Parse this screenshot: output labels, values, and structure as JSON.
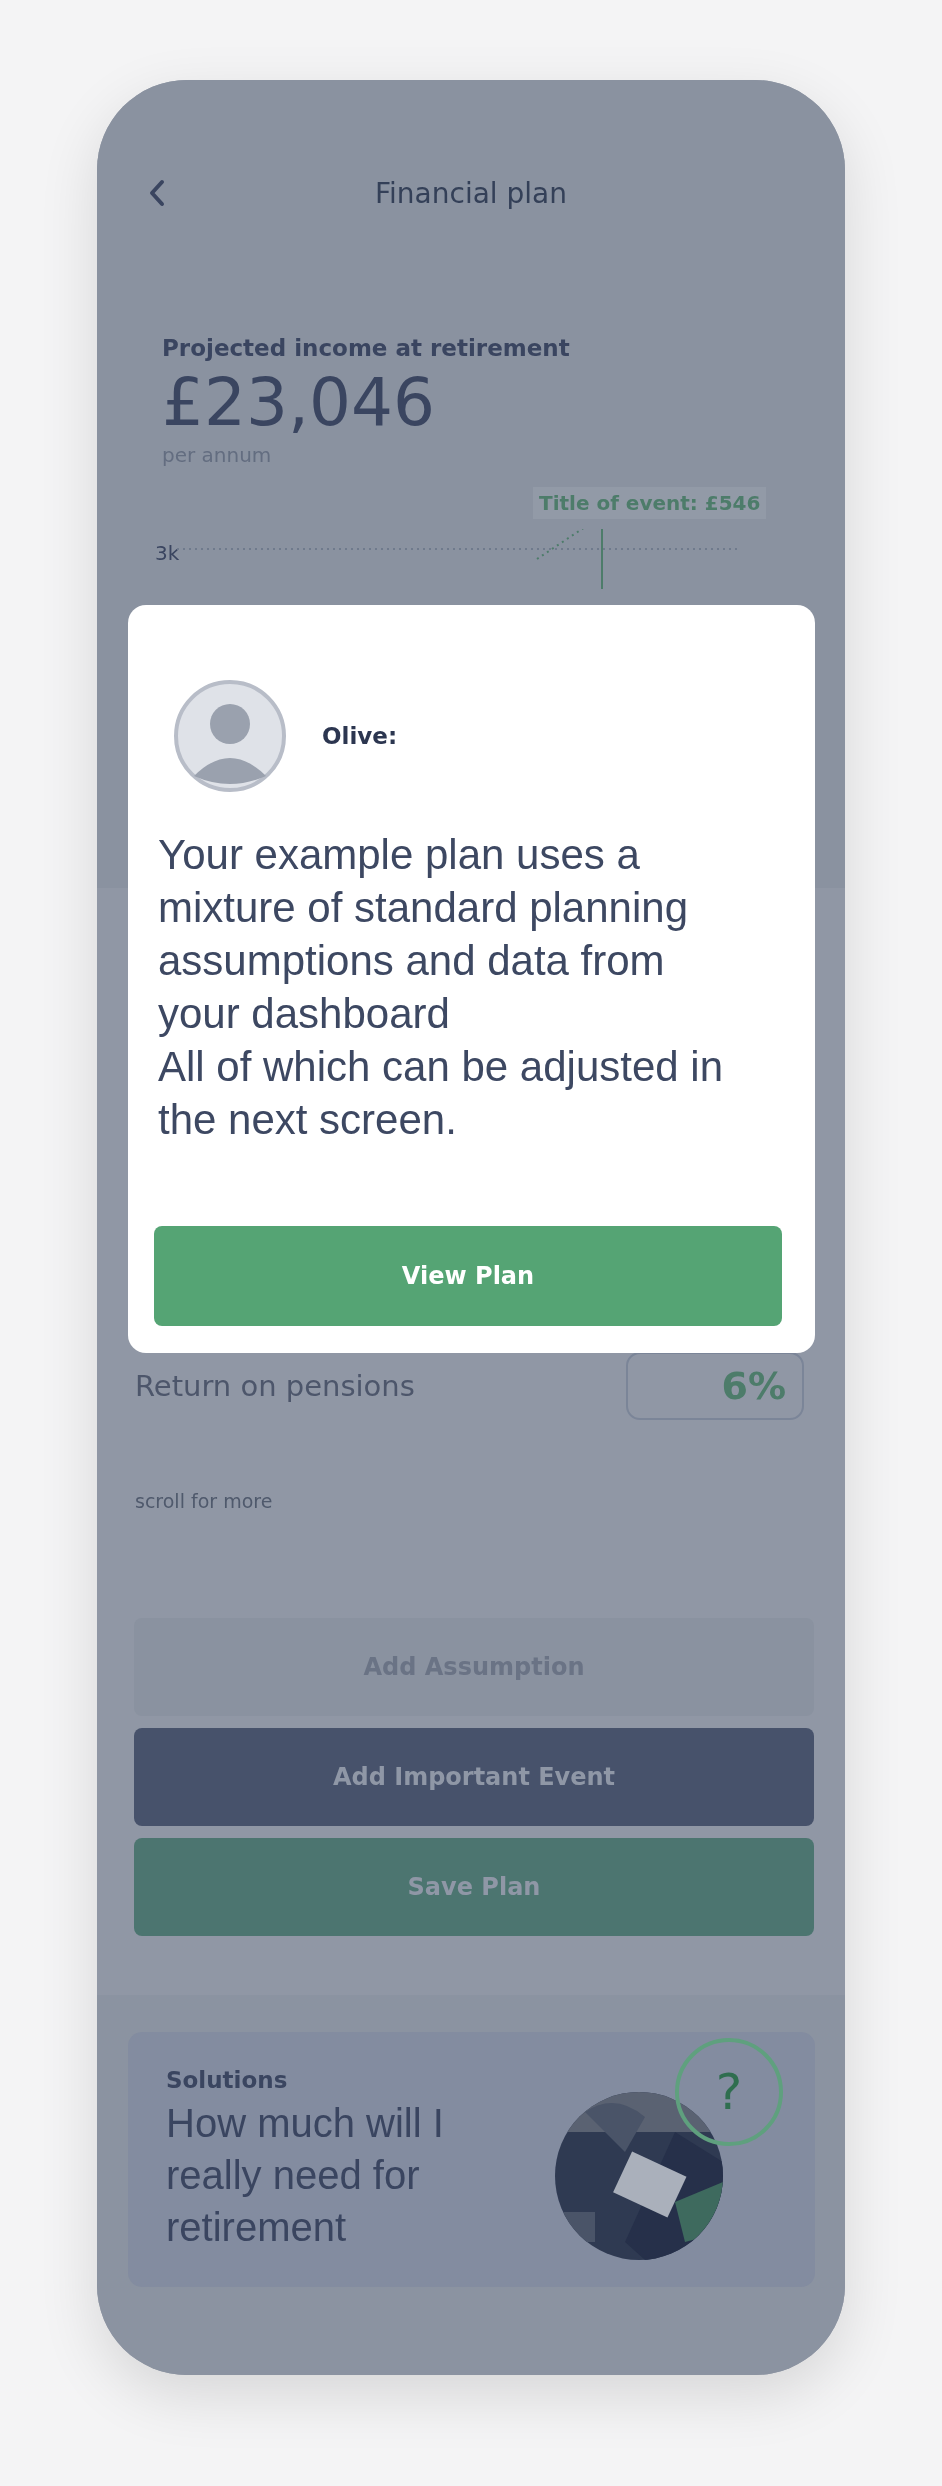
{
  "header": {
    "title": "Financial plan"
  },
  "summary": {
    "label": "Projected income at retirement",
    "amount": "£23,046",
    "period": "per annum"
  },
  "chart": {
    "event_label": "Title of event: £546",
    "y_tick": "3k"
  },
  "assumptions": [
    {
      "label": "Return on pensions",
      "value": "6%"
    }
  ],
  "scroll_hint": "scroll for more",
  "actions": [
    {
      "label": "Add Assumption",
      "kind": "secondary"
    },
    {
      "label": "Add Important Event",
      "kind": "primary"
    },
    {
      "label": "Save Plan",
      "kind": "success"
    }
  ],
  "solutions_card": {
    "category": "Solutions",
    "title": "How much will I really need for retirement",
    "badge": "?"
  },
  "dialog": {
    "speaker": "Olive:",
    "message": "Your example plan uses a mixture of standard planning assumptions and data from your dashboard\nAll of which can be adjusted in the next screen.",
    "button": "View Plan"
  }
}
